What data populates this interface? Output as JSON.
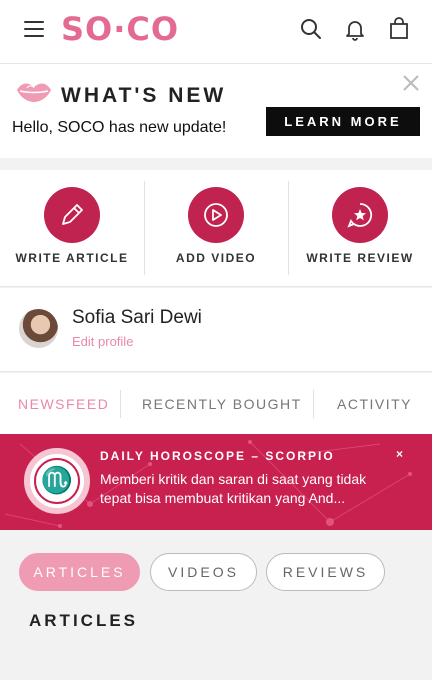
{
  "header": {
    "logo": "SO·CO",
    "menu_icon": "hamburger-icon",
    "search_icon": "search-icon",
    "notification_icon": "bell-icon",
    "cart_icon": "shopping-bag-icon"
  },
  "whats_new": {
    "title": "WHAT'S NEW",
    "message": "Hello, SOCO has new update!",
    "button_label": "LEARN MORE",
    "close_icon": "close-icon"
  },
  "actions": [
    {
      "label": "WRITE ARTICLE",
      "icon": "pencil-icon"
    },
    {
      "label": "ADD VIDEO",
      "icon": "play-icon"
    },
    {
      "label": "WRITE REVIEW",
      "icon": "star-bubble-icon"
    }
  ],
  "profile": {
    "name": "Sofia Sari Dewi",
    "edit_label": "Edit profile"
  },
  "tabs": [
    {
      "label": "NEWSFEED",
      "active": true
    },
    {
      "label": "RECENTLY BOUGHT",
      "active": false
    },
    {
      "label": "ACTIVITY",
      "active": false
    }
  ],
  "horoscope": {
    "title": "DAILY HOROSCOPE – SCORPIO",
    "text": "Memberi kritik dan saran di saat yang tidak tepat bisa membuat kritikan yang And...",
    "sign_glyph": "♏",
    "close_label": "×"
  },
  "filters": [
    {
      "label": "ARTICLES",
      "active": true
    },
    {
      "label": "VIDEOS",
      "active": false
    },
    {
      "label": "REVIEWS",
      "active": false
    }
  ],
  "section_title": "ARTICLES",
  "colors": {
    "brand_pink": "#e36b92",
    "accent_red": "#c02350",
    "active_pill": "#f09bb4"
  }
}
